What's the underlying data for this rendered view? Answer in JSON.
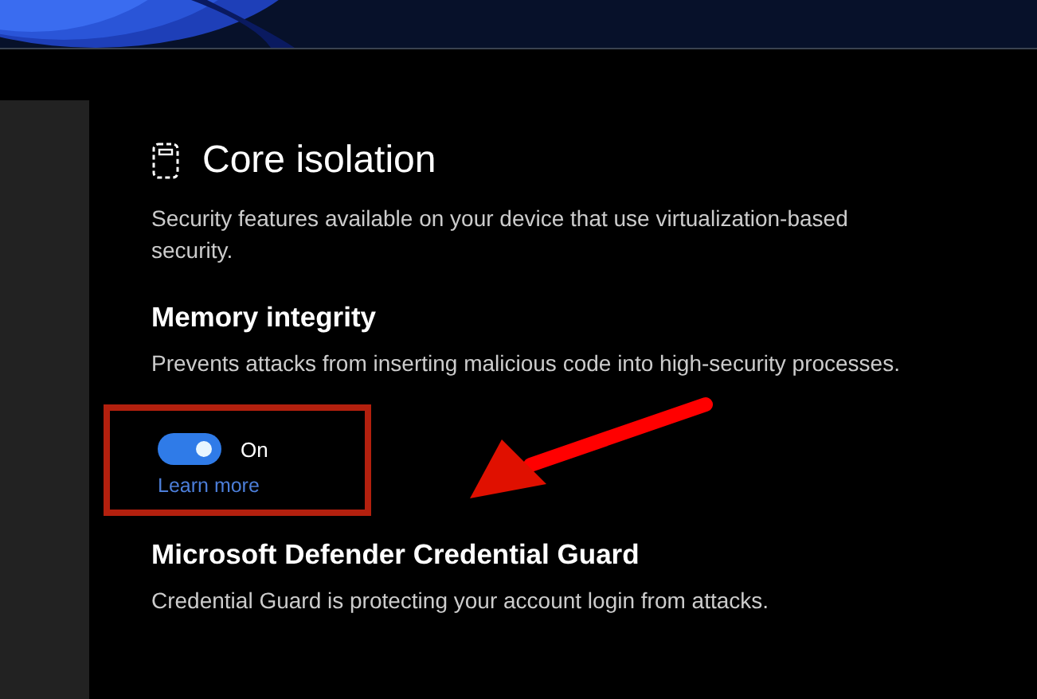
{
  "page": {
    "title": "Core isolation",
    "description": "Security features available on your device that use virtualization-based security."
  },
  "sections": [
    {
      "kind": "toggle",
      "heading": "Memory integrity",
      "description": "Prevents attacks from inserting malicious code into high-security processes.",
      "toggle": {
        "on": true,
        "label": "On"
      },
      "link": "Learn more",
      "highlighted": true
    },
    {
      "kind": "info",
      "heading": "Microsoft Defender Credential Guard",
      "description": "Credential Guard is protecting your account login from attacks."
    }
  ]
}
